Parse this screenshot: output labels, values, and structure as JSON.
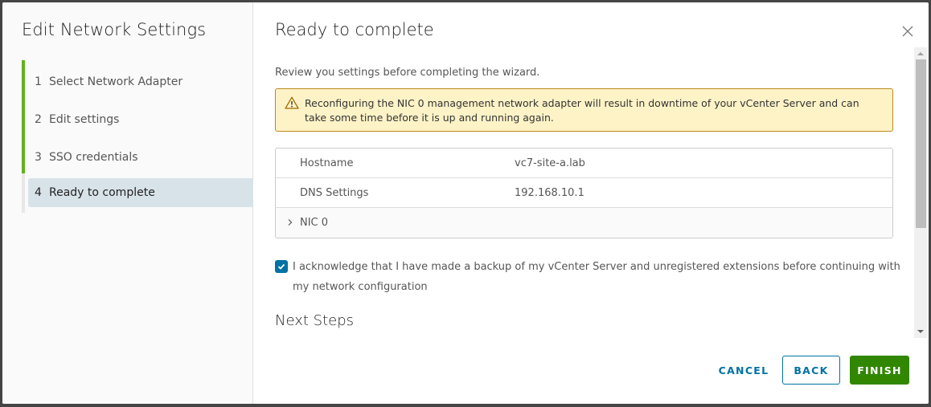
{
  "sidebar": {
    "title": "Edit Network Settings",
    "steps": [
      {
        "number": "1",
        "label": "Select Network Adapter",
        "state": "complete"
      },
      {
        "number": "2",
        "label": "Edit settings",
        "state": "complete"
      },
      {
        "number": "3",
        "label": "SSO credentials",
        "state": "complete"
      },
      {
        "number": "4",
        "label": "Ready to complete",
        "state": "active"
      }
    ],
    "progress_color": "#62b21c"
  },
  "main": {
    "title": "Ready to complete",
    "close_icon": "close-icon",
    "intro": "Review you settings before completing the wizard.",
    "alert": {
      "icon": "warning-icon",
      "text": "Reconfiguring the NIC 0 management network adapter will result in downtime of your vCenter Server and can take some time before it is up and running again."
    },
    "summary": [
      {
        "key": "Hostname",
        "value": "vc7-site-a.lab"
      },
      {
        "key": "DNS Settings",
        "value": "192.168.10.1"
      },
      {
        "key": "NIC 0",
        "value": "",
        "expandable": true,
        "expanded": false
      }
    ],
    "acknowledge": {
      "checked": true,
      "label": "I acknowledge that I have made a backup of my vCenter Server and unregistered extensions before continuing with my network configuration"
    },
    "next_steps_heading": "Next Steps"
  },
  "footer": {
    "cancel_label": "CANCEL",
    "back_label": "BACK",
    "finish_label": "FINISH"
  },
  "colors": {
    "accent": "#0072a3",
    "primary_button": "#318700",
    "alert_bg": "#fef3c7",
    "alert_border": "#b98a1d"
  }
}
